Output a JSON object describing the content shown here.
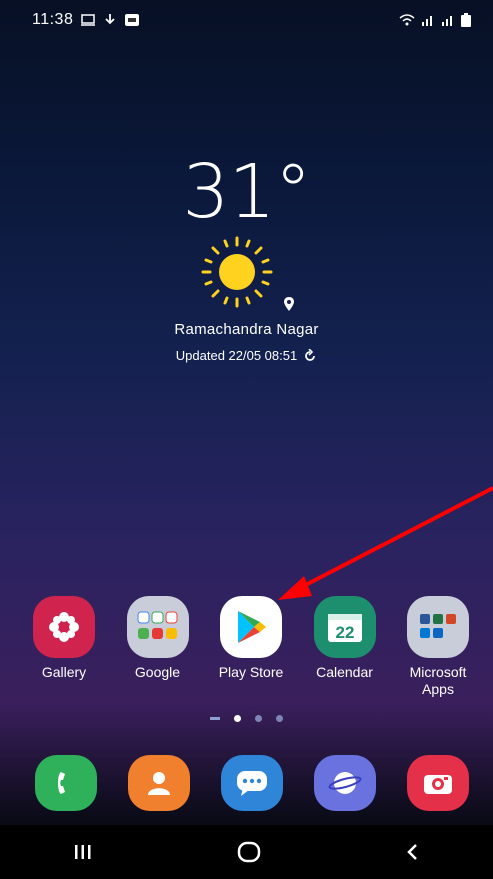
{
  "status_bar": {
    "time": "11:38"
  },
  "weather": {
    "temperature": "31°",
    "location": "Ramachandra Nagar",
    "updated": "Updated 22/05 08:51"
  },
  "home_apps": [
    {
      "label": "Gallery",
      "icon": "gallery-icon"
    },
    {
      "label": "Google",
      "icon": "google-folder-icon"
    },
    {
      "label": "Play Store",
      "icon": "play-store-icon"
    },
    {
      "label": "Calendar",
      "icon": "calendar-icon",
      "date": "22"
    },
    {
      "label": "Microsoft\nApps",
      "label_line1": "Microsoft",
      "label_line2": "Apps",
      "icon": "microsoft-folder-icon"
    }
  ],
  "dock": [
    {
      "icon": "phone-icon"
    },
    {
      "icon": "contacts-icon"
    },
    {
      "icon": "messages-icon"
    },
    {
      "icon": "internet-icon"
    },
    {
      "icon": "camera-icon"
    }
  ],
  "colors": {
    "gallery": "#d0234e",
    "calendar": "#1e8f6e",
    "phone": "#2fb05a",
    "contacts": "#f07f2e",
    "messages": "#2f86d8",
    "internet": "#6a72e0",
    "camera": "#e5304a",
    "annotation_arrow": "#ff0000"
  }
}
